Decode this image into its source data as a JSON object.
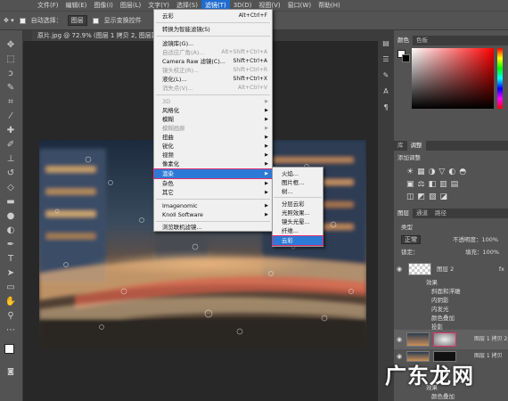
{
  "menubar": {
    "items": [
      "文件(F)",
      "编辑(E)",
      "图像(I)",
      "图层(L)",
      "文字(Y)",
      "选择(S)",
      "滤镜(T)",
      "3D(D)",
      "视图(V)",
      "窗口(W)",
      "帮助(H)"
    ]
  },
  "options": {
    "auto_select": "自动选择：",
    "layer_select": "图层",
    "show_transform": "显示变换控件"
  },
  "tab": {
    "title": "原片.jpg @ 72.9% (图层 1 拷贝 2, 图层蒙板/8) *"
  },
  "filter_menu": {
    "items": [
      {
        "label": "云彩",
        "shortcut": "Alt+Ctrl+F"
      },
      {
        "label": "转换为智能滤镜(S)"
      },
      {
        "label": "滤镜库(G)..."
      },
      {
        "label": "自适应广角(A)...",
        "shortcut": "Alt+Shift+Ctrl+A",
        "disabled": true
      },
      {
        "label": "Camera Raw 滤镜(C)...",
        "shortcut": "Shift+Ctrl+A"
      },
      {
        "label": "镜头校正(R)...",
        "shortcut": "Shift+Ctrl+R",
        "disabled": true
      },
      {
        "label": "液化(L)...",
        "shortcut": "Shift+Ctrl+X"
      },
      {
        "label": "消失点(V)...",
        "shortcut": "Alt+Ctrl+V",
        "disabled": true
      },
      {
        "label": "3D",
        "submenu": true,
        "disabled": true
      },
      {
        "label": "风格化",
        "submenu": true
      },
      {
        "label": "模糊",
        "submenu": true
      },
      {
        "label": "模糊画廊",
        "submenu": true,
        "disabled": true
      },
      {
        "label": "扭曲",
        "submenu": true
      },
      {
        "label": "锐化",
        "submenu": true
      },
      {
        "label": "视频",
        "submenu": true
      },
      {
        "label": "像素化",
        "submenu": true
      },
      {
        "label": "渲染",
        "submenu": true,
        "highlighted": true
      },
      {
        "label": "杂色",
        "submenu": true
      },
      {
        "label": "其它",
        "submenu": true
      },
      {
        "label": "Imagenomic",
        "submenu": true
      },
      {
        "label": "Knoll Software",
        "submenu": true
      },
      {
        "label": "浏览联机滤镜..."
      }
    ]
  },
  "render_submenu": {
    "items": [
      {
        "label": "火焰..."
      },
      {
        "label": "图片框..."
      },
      {
        "label": "树..."
      },
      {
        "label": "分层云彩"
      },
      {
        "label": "光照效果..."
      },
      {
        "label": "镜头光晕..."
      },
      {
        "label": "纤维..."
      },
      {
        "label": "云彩",
        "highlighted": true
      }
    ]
  },
  "panels": {
    "color_tabs": [
      "颜色",
      "色板"
    ],
    "adjust_tabs": [
      "库",
      "调整"
    ],
    "adjust_title": "添加调整",
    "layers_tabs": [
      "图层",
      "通道",
      "路径"
    ],
    "kind": "类型",
    "blend": "正常",
    "opacity": "不透明度：100%",
    "lock": "锁定：",
    "fill": "填充：100%",
    "layers": [
      {
        "name": "图层 2"
      },
      {
        "name": "效果",
        "sub": true
      },
      {
        "name": "斜面和浮雕",
        "sub": true
      },
      {
        "name": "内阴影",
        "sub": true
      },
      {
        "name": "内发光",
        "sub": true
      },
      {
        "name": "颜色叠加",
        "sub": true
      },
      {
        "name": "投影",
        "sub": true
      },
      {
        "name": "图层 1 拷贝 2"
      },
      {
        "name": "图层 1 拷贝"
      },
      {
        "name": "效果",
        "sub": true
      },
      {
        "name": "颜色叠加",
        "sub": true
      }
    ]
  },
  "watermark": "广东龙网",
  "colors": {
    "highlight": "#2d7ad6",
    "outline": "#e0306f",
    "panel": "#535353"
  }
}
